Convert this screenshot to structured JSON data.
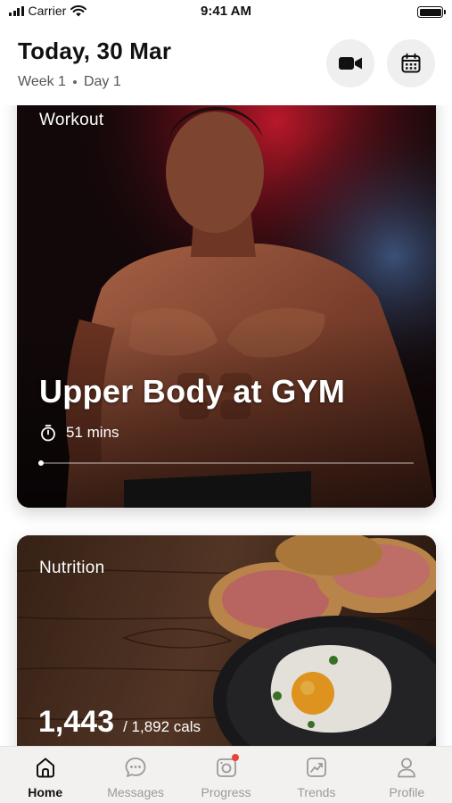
{
  "status_bar": {
    "carrier": "Carrier",
    "time": "9:41 AM"
  },
  "header": {
    "title": "Today, 30 Mar",
    "week": "Week 1",
    "day": "Day 1",
    "icons": [
      "video-camera-icon",
      "calendar-icon"
    ]
  },
  "workout": {
    "label": "Workout",
    "title": "Upper Body at GYM",
    "duration": "51 mins",
    "progress": 0.0
  },
  "nutrition": {
    "label": "Nutrition",
    "current": "1,443",
    "total": "/ 1,892 cals"
  },
  "tabs": [
    {
      "label": "Home",
      "icon": "home-icon",
      "active": true
    },
    {
      "label": "Messages",
      "icon": "chat-icon",
      "active": false
    },
    {
      "label": "Progress",
      "icon": "camera-icon",
      "active": false,
      "badge": true
    },
    {
      "label": "Trends",
      "icon": "trend-chart-icon",
      "active": false
    },
    {
      "label": "Profile",
      "icon": "user-icon",
      "active": false
    }
  ],
  "colors": {
    "accent_badge": "#e8443a",
    "tab_inactive": "#9a9a9a",
    "tab_active": "#111111"
  }
}
